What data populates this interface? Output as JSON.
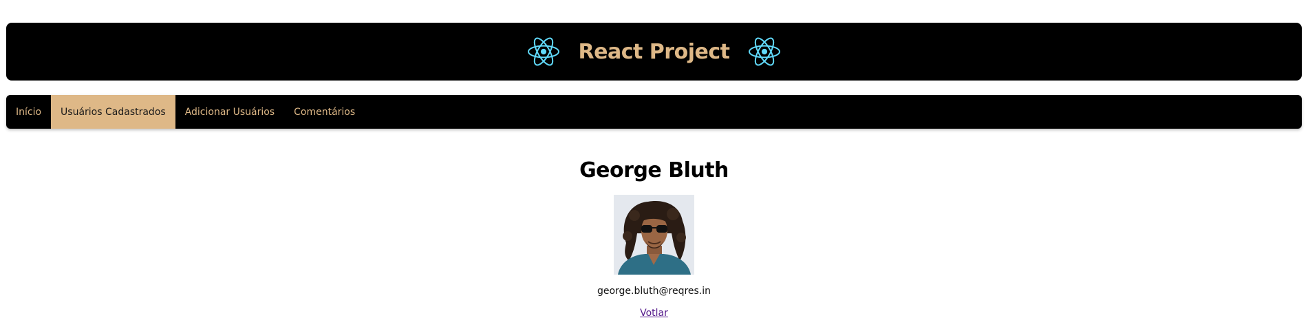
{
  "header": {
    "title": "React Project",
    "logo_icon": "react-logo-icon",
    "title_color": "#deb887",
    "logo_color": "#61dafb"
  },
  "nav": {
    "items": [
      {
        "label": "Início",
        "active": false
      },
      {
        "label": "Usuários Cadastrados",
        "active": true
      },
      {
        "label": "Adicionar Usuários",
        "active": false
      },
      {
        "label": "Comentários",
        "active": false
      }
    ],
    "active_bg": "#deb887"
  },
  "user": {
    "name": "George Bluth",
    "email": "george.bluth@reqres.in",
    "avatar_icon": "user-avatar-photo"
  },
  "actions": {
    "back_label": "Votlar"
  }
}
